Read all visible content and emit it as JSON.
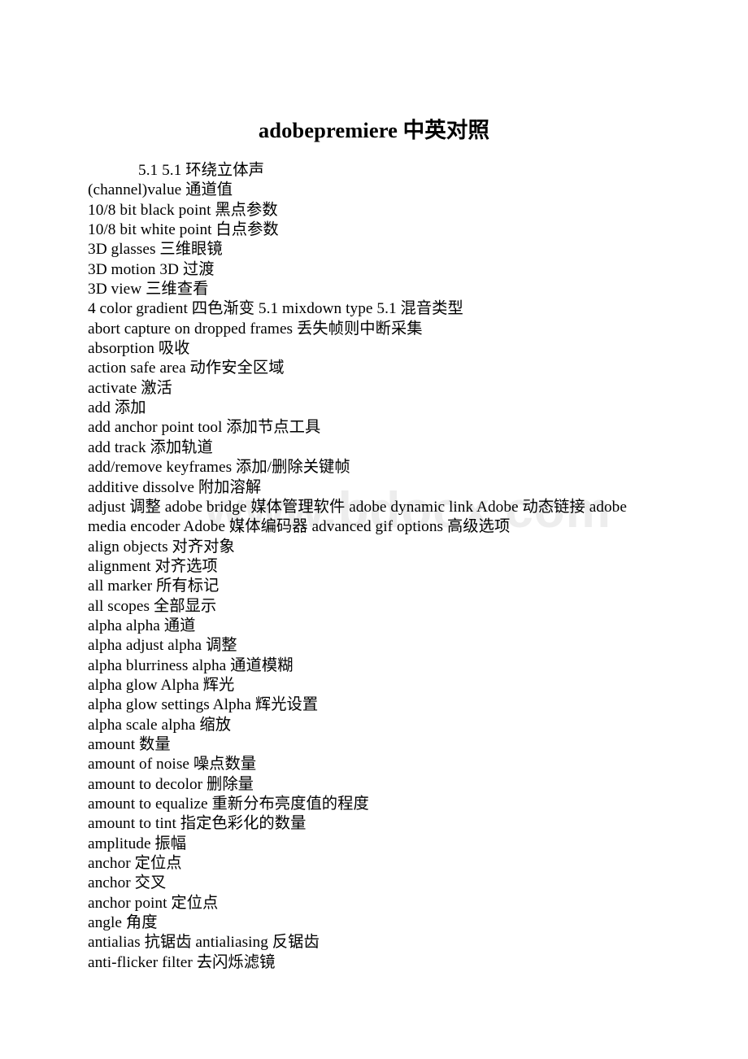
{
  "document": {
    "title": "adobepremiere 中英对照",
    "watermark": "www.bdocx.com",
    "lines": [
      {
        "text": "5.1 5.1 环绕立体声",
        "indented": true,
        "wrapped": false
      },
      {
        "text": "(channel)value 通道值",
        "indented": false,
        "wrapped": false
      },
      {
        "text": "10/8 bit black point 黑点参数",
        "indented": false,
        "wrapped": false
      },
      {
        "text": "10/8 bit white point 白点参数",
        "indented": false,
        "wrapped": false
      },
      {
        "text": "3D glasses 三维眼镜",
        "indented": false,
        "wrapped": false
      },
      {
        "text": "3D motion 3D 过渡",
        "indented": false,
        "wrapped": false
      },
      {
        "text": "3D view 三维查看",
        "indented": false,
        "wrapped": false
      },
      {
        "text": "4 color gradient 四色渐变 5.1 mixdown type 5.1 混音类型",
        "indented": false,
        "wrapped": false
      },
      {
        "text": "abort capture on dropped frames 丢失帧则中断采集",
        "indented": false,
        "wrapped": false
      },
      {
        "text": "absorption 吸收",
        "indented": false,
        "wrapped": false
      },
      {
        "text": "action safe area 动作安全区域",
        "indented": false,
        "wrapped": false
      },
      {
        "text": "activate 激活",
        "indented": false,
        "wrapped": false
      },
      {
        "text": "add 添加",
        "indented": false,
        "wrapped": false
      },
      {
        "text": "add anchor point tool 添加节点工具",
        "indented": false,
        "wrapped": false
      },
      {
        "text": "add track 添加轨道",
        "indented": false,
        "wrapped": false
      },
      {
        "text": "add/remove keyframes 添加/删除关键帧",
        "indented": false,
        "wrapped": false
      },
      {
        "text": "additive dissolve 附加溶解",
        "indented": false,
        "wrapped": false
      },
      {
        "text": "adjust 调整 adobe bridge 媒体管理软件 adobe dynamic link Adobe 动态链接 adobe media encoder Adobe 媒体编码器 advanced gif options 高级选项",
        "indented": false,
        "wrapped": true
      },
      {
        "text": "align objects 对齐对象",
        "indented": false,
        "wrapped": false
      },
      {
        "text": "alignment 对齐选项",
        "indented": false,
        "wrapped": false
      },
      {
        "text": "all marker 所有标记",
        "indented": false,
        "wrapped": false
      },
      {
        "text": "all scopes 全部显示",
        "indented": false,
        "wrapped": false
      },
      {
        "text": "alpha alpha 通道",
        "indented": false,
        "wrapped": false
      },
      {
        "text": "alpha adjust alpha 调整",
        "indented": false,
        "wrapped": false
      },
      {
        "text": "alpha blurriness alpha 通道模糊",
        "indented": false,
        "wrapped": false
      },
      {
        "text": "alpha glow Alpha 辉光",
        "indented": false,
        "wrapped": false
      },
      {
        "text": "alpha glow settings Alpha 辉光设置",
        "indented": false,
        "wrapped": false
      },
      {
        "text": "alpha scale alpha 缩放",
        "indented": false,
        "wrapped": false
      },
      {
        "text": "amount 数量",
        "indented": false,
        "wrapped": false
      },
      {
        "text": "amount of noise 噪点数量",
        "indented": false,
        "wrapped": false
      },
      {
        "text": "amount to decolor 删除量",
        "indented": false,
        "wrapped": false
      },
      {
        "text": "amount to equalize 重新分布亮度值的程度",
        "indented": false,
        "wrapped": false
      },
      {
        "text": "amount to tint 指定色彩化的数量",
        "indented": false,
        "wrapped": false
      },
      {
        "text": "amplitude 振幅",
        "indented": false,
        "wrapped": false
      },
      {
        "text": "anchor 定位点",
        "indented": false,
        "wrapped": false
      },
      {
        "text": "anchor 交叉",
        "indented": false,
        "wrapped": false
      },
      {
        "text": "anchor point 定位点",
        "indented": false,
        "wrapped": false
      },
      {
        "text": "angle 角度",
        "indented": false,
        "wrapped": false
      },
      {
        "text": "antialias 抗锯齿 antialiasing 反锯齿",
        "indented": false,
        "wrapped": false
      },
      {
        "text": "anti-flicker filter 去闪烁滤镜",
        "indented": false,
        "wrapped": false
      }
    ]
  }
}
